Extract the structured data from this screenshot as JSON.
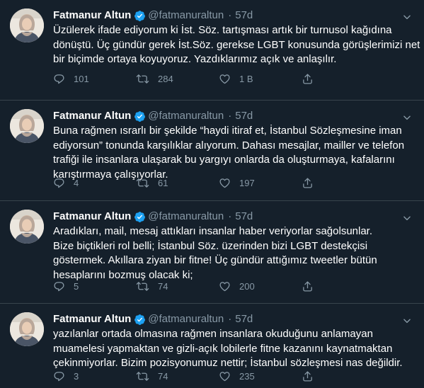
{
  "colors": {
    "background": "#15202b",
    "text": "#ffffff",
    "muted": "#8899a6",
    "verified": "#1da1f2",
    "divider": "#38444d"
  },
  "tweets": [
    {
      "name": "Fatmanur Altun",
      "handle": "@fatmanuraltun",
      "separator": "·",
      "time": "57d",
      "lines": [
        "Üzülerek ifade ediyorum ki İst. Söz. tartışması artık bir turnusol kağıdına",
        "dönüştü. Üç gündür gerek İst.Söz. gerekse LGBT konusunda görüşlerimizi net",
        "bir biçimde ortaya koyuyoruz. Yazdıklarımız açık ve anlaşılır."
      ],
      "replies": "101",
      "retweets": "284",
      "likes": "1 B"
    },
    {
      "name": "Fatmanur Altun",
      "handle": "@fatmanuraltun",
      "separator": "·",
      "time": "57d",
      "lines": [
        "Buna rağmen ısrarlı bir şekilde “haydi itiraf et, İstanbul Sözleşmesine iman",
        "ediyorsun” tonunda karşılıklar alıyorum. Dahası mesajlar, mailler ve telefon",
        "trafiği ile insanlara ulaşarak bu yargıyı onlarda da oluşturmaya, kafalarını",
        "karıştırmaya çalışıyorlar."
      ],
      "replies": "4",
      "retweets": "61",
      "likes": "197"
    },
    {
      "name": "Fatmanur Altun",
      "handle": "@fatmanuraltun",
      "separator": "·",
      "time": "57d",
      "lines": [
        "Aradıkları, mail, mesaj attıkları insanlar haber veriyorlar sağolsunlar.",
        "Bize biçtikleri rol belli; İstanbul Söz. üzerinden bizi LGBT destekçisi",
        "göstermek. Akıllara ziyan bir fitne! Üç gündür attığımız tweetler bütün",
        "hesaplarını bozmuş olacak ki;"
      ],
      "replies": "5",
      "retweets": "74",
      "likes": "200"
    },
    {
      "name": "Fatmanur Altun",
      "handle": "@fatmanuraltun",
      "separator": "·",
      "time": "57d",
      "lines": [
        "yazılanlar ortada olmasına rağmen insanlara okuduğunu anlamayan",
        "muamelesi yapmaktan ve gizli-açık lobilerle fitne kazanını kaynatmaktan",
        "çekinmiyorlar. Bizim pozisyonumuz nettir; İstanbul sözleşmesi nas değildir."
      ],
      "replies": "3",
      "retweets": "74",
      "likes": "235"
    }
  ]
}
